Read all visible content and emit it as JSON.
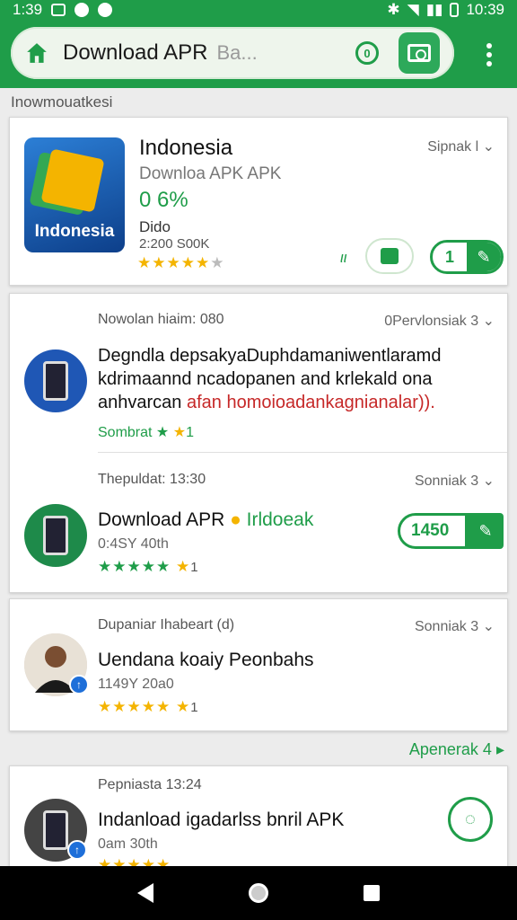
{
  "status_bar": {
    "time_left": "1:39",
    "time_right": "10:39"
  },
  "app_bar": {
    "title": "Download APR",
    "hint": "Ba..."
  },
  "breadcrumb": "Inowmouatkesi",
  "featured": {
    "icon_label": "Indonesia",
    "name": "Indonesia",
    "subtitle": "Downloa APK APK",
    "percent": "0 6%",
    "developer": "Dido",
    "downloads": "2:200 S00K",
    "meta": "Sipnak l",
    "count": "ιι",
    "pill_number": "1",
    "rating": 4.5
  },
  "items": [
    {
      "head": "Nowolan  hiaim: 080",
      "meta": "0Pervlonsiak 3",
      "desc_black": "Degndla depsakyaDuphdamaniwentlaramd kdrimaannd ncadopanen and krlekald ona anhvarcan",
      "desc_red": "afan homoioadankagnianalar)).",
      "source": "Sombrat",
      "rating_count": "1"
    },
    {
      "head": "Thepuldat: 13:30",
      "meta": "Sonniak 3",
      "title": "Download APR",
      "title_green": "Irldoeak",
      "sub": "0:4SY 40th",
      "price": "1450",
      "rating_count": "1"
    },
    {
      "head": "Dupaniar  Ihabeart (d)",
      "meta": "Sonniak 3",
      "title": "Uendana koaiy Peonbahs",
      "sub": "1149Y 20a0",
      "rating_count": "1"
    },
    {
      "head": "Pepniasta 13:24",
      "title": "Indanload igadarlss bnril APK",
      "sub": "0am 30th"
    }
  ],
  "more_link": "Apenerak 4",
  "colors": {
    "brand_green": "#1f9d49",
    "star_gold": "#f4b400",
    "accent_red": "#c62828"
  }
}
